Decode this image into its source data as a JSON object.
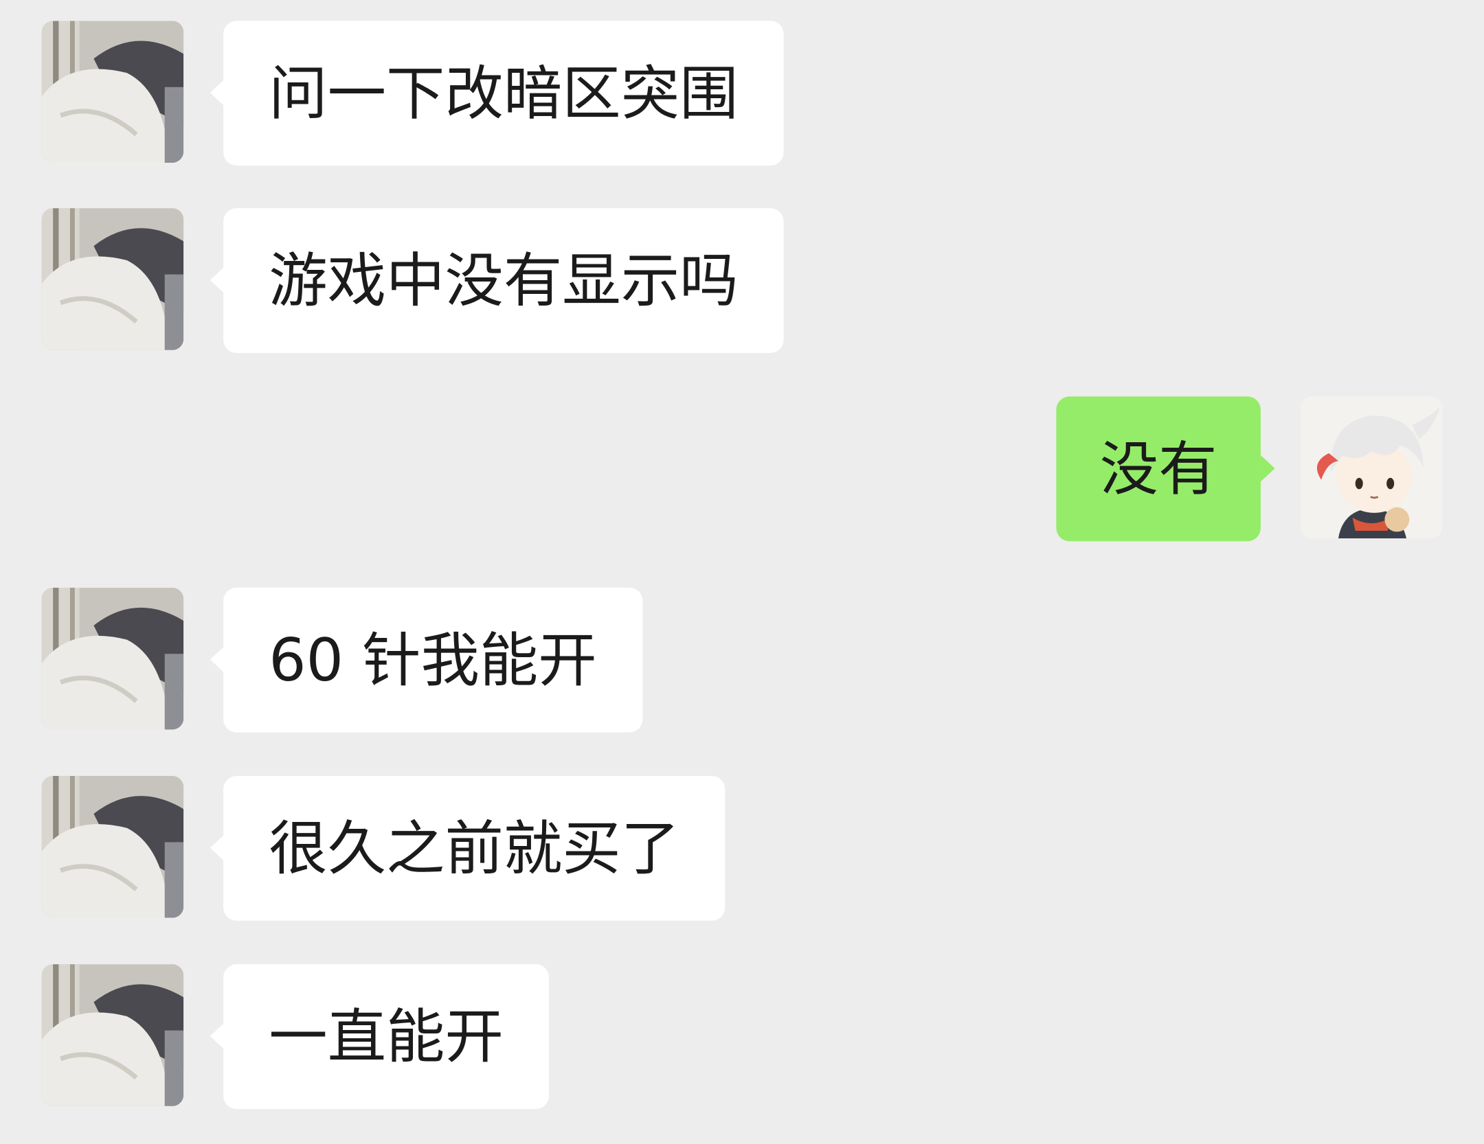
{
  "messages": [
    {
      "direction": "in",
      "text": "问一下改暗区突围"
    },
    {
      "direction": "in",
      "text": "游戏中没有显示吗"
    },
    {
      "direction": "out",
      "text": "没有"
    },
    {
      "direction": "in",
      "text": "60 针我能开"
    },
    {
      "direction": "in",
      "text": "很久之前就买了"
    },
    {
      "direction": "in",
      "text": "一直能开"
    }
  ],
  "colors": {
    "background": "#ededed",
    "incoming_bubble": "#ffffff",
    "outgoing_bubble": "#95ec69",
    "text": "#1b1b1b"
  }
}
